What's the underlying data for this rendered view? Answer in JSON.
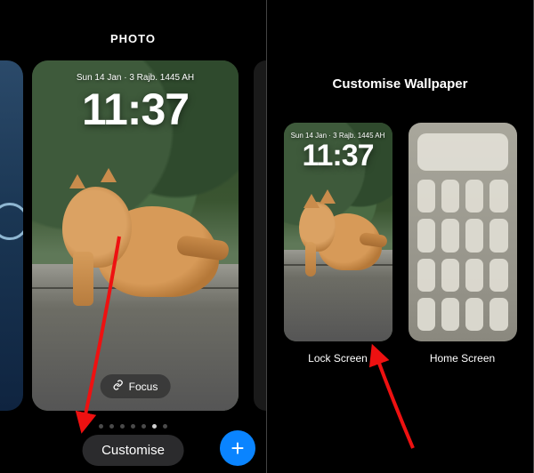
{
  "left": {
    "header": "PHOTO",
    "date": "Sun 14 Jan · 3 Rajb. 1445 AH",
    "time": "11:37",
    "focus_label": "Focus",
    "customise_label": "Customise",
    "add_aria": "Add wallpaper",
    "dot_count": 7,
    "active_dot": 5
  },
  "right": {
    "title": "Customise Wallpaper",
    "lock": {
      "date": "Sun 14 Jan · 3 Rajb. 1445 AH",
      "time": "11:37",
      "label": "Lock Screen"
    },
    "home": {
      "label": "Home Screen",
      "app_count": 16
    }
  }
}
